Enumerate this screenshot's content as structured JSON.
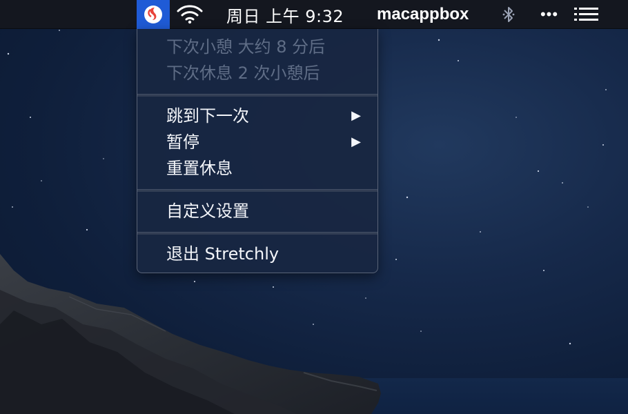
{
  "menubar": {
    "app_icon": "stretchly-icon",
    "wifi_icon": "wifi-icon",
    "clock": "周日 上午 9:32",
    "username": "macappbox",
    "bluetooth_icon": "bluetooth-icon",
    "more_label": "•••",
    "list_icon": "list-icon"
  },
  "menu": {
    "status": [
      "下次小憩 大约 8 分后",
      "下次休息 2 次小憩后"
    ],
    "items": [
      {
        "label": "跳到下一次",
        "submenu": "▶"
      },
      {
        "label": "暂停",
        "submenu": "▶"
      },
      {
        "label": "重置休息"
      },
      {
        "label": "自定义设置"
      },
      {
        "label": "退出 Stretchly"
      }
    ]
  },
  "colors": {
    "menubar_bg": "#14171f",
    "selected_icon_bg": "#1f5bd6",
    "menu_bg": "#182642",
    "disabled_text": "#5f6d86",
    "text": "#f4f6fa"
  }
}
